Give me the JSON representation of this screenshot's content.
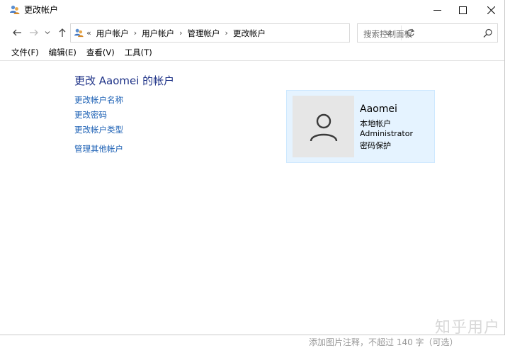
{
  "window": {
    "title": "更改帐户",
    "controls": {
      "minimize": "—",
      "maximize": "☐",
      "close": "✕"
    }
  },
  "address": {
    "overflow": "«",
    "breadcrumbs": [
      "用户帐户",
      "用户帐户",
      "管理帐户",
      "更改帐户"
    ],
    "separator": "›"
  },
  "search": {
    "placeholder": "搜索控制面板"
  },
  "menu": [
    "文件(F)",
    "编辑(E)",
    "查看(V)",
    "工具(T)"
  ],
  "page": {
    "heading": "更改 Aaomei 的帐户",
    "links": [
      "更改帐户名称",
      "更改密码",
      "更改帐户类型",
      "管理其他帐户"
    ]
  },
  "account": {
    "name": "Aaomei",
    "type": "本地帐户",
    "role": "Administrator",
    "protection": "密码保护"
  },
  "watermark": "知乎用户",
  "background_text": "添加图片注释，不超过 140 字（可选）"
}
